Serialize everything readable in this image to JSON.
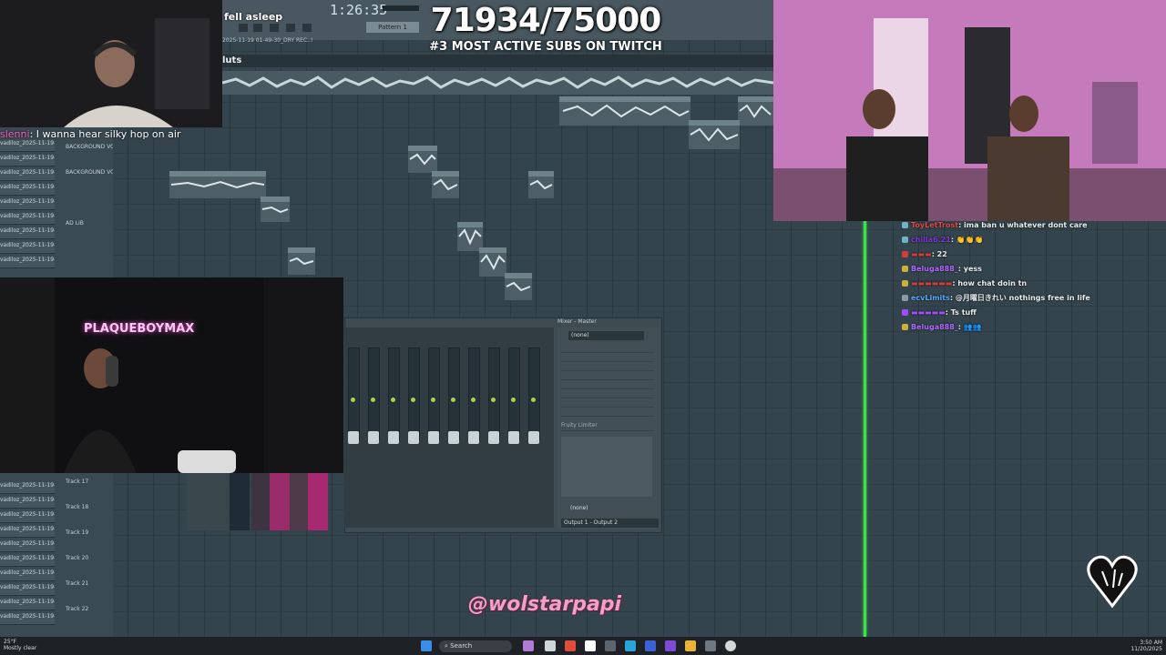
{
  "stream": {
    "sub_count": "71934/75000",
    "sub_subtitle": "#3 MOST ACTIVE SUBS ON TWITCH",
    "watermark": "@wolstarpapi",
    "overlay_text_top": "fell asleep",
    "cam_sign": "PLAQUEBOYMAX",
    "cam_chat_user": "slenni",
    "cam_chat_message": ": I wanna hear silky hop on air"
  },
  "fl_studio": {
    "song_time": "1:26:35",
    "pattern": "Pattern 1",
    "playlist_title": "luts",
    "clip_name_top": "2025-11-19 01-49-30_DRY REC..!",
    "track_labels": [
      "vadiloz_2025-11-19-18-2",
      "BACKGROUND VOCAL",
      "BACKGROUND VOCAL",
      "AD LIB",
      "Track 17",
      "Track 18",
      "Track 19",
      "Track 20",
      "Track 21",
      "Track 22"
    ],
    "mixer": {
      "title": "Mixer - Master",
      "preset": "(none)",
      "slots": [
        "Fruity Limiter"
      ],
      "output": "Output 1 - Output 2",
      "insert_none": "(none)"
    }
  },
  "chat": {
    "lines": [
      {
        "user": "ToyLetTrost",
        "message": ": ima ban u whatever dont care",
        "color": "#e14a4a"
      },
      {
        "user": "chilla6.21",
        "message": ": 👏👏👏",
        "color": "#7b3ad6"
      },
      {
        "user": "▬▬▬",
        "message": ": 22",
        "color": "#d13c3c"
      },
      {
        "user": "Beluga888_",
        "message": ": yess",
        "color": "#b26bff"
      },
      {
        "user": "▬▬▬▬▬▬",
        "message": ": how chat doin tn",
        "color": "#d13c3c"
      },
      {
        "user": "ecvLimits",
        "message": ": @月曜日きれい nothings free in life",
        "color": "#5aa7ff"
      },
      {
        "user": "▬▬▬▬▬",
        "message": ": Ts tuff",
        "color": "#a34cff"
      },
      {
        "user": "Beluga888_",
        "message": ": 👥👥",
        "color": "#b26bff"
      }
    ]
  },
  "taskbar": {
    "weather_temp": "25°F",
    "weather_text": "Mostly clear",
    "search_placeholder": "Search",
    "time": "3:50 AM",
    "date": "11/20/2025"
  },
  "colors": {
    "accent_green": "#3ee04b",
    "watermark_pink": "#f2a0c6",
    "playlist_bg": "#34444d"
  }
}
